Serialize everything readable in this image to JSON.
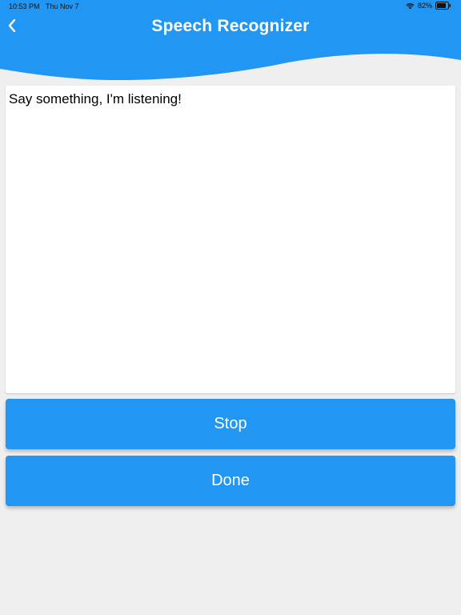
{
  "status_bar": {
    "time": "10:53 PM",
    "date": "Thu Nov 7",
    "battery": "82%"
  },
  "header": {
    "title": "Speech Recognizer",
    "back_icon": "chevron-left-icon"
  },
  "transcript": {
    "text": "Say something, I'm listening!"
  },
  "buttons": {
    "stop_label": "Stop",
    "done_label": "Done"
  },
  "colors": {
    "primary": "#2196f3",
    "background": "#efefef",
    "header_text": "#ffffff"
  }
}
